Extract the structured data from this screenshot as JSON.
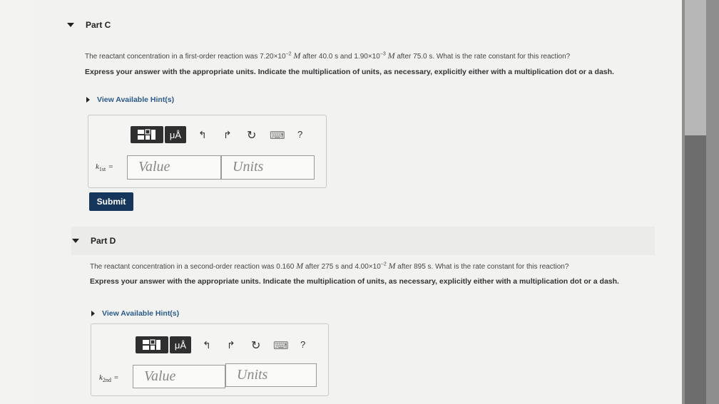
{
  "part_c": {
    "title": "Part C",
    "question_prefix": "The reactant concentration in a first-order reaction was 7.20×10",
    "exp1": "−2",
    "unit1": "M",
    "question_middle": " after 40.0 s and 1.90×10",
    "exp2": "−3",
    "unit2": "M",
    "question_suffix": " after 75.0 s. What is the rate constant for this reaction?",
    "instructions": "Express your answer with the appropriate units. Indicate the multiplication of units, as necessary, explicitly either with a multiplication dot or a dash.",
    "hint": "View Available Hint(s)",
    "var_main": "k",
    "var_sub": "1st",
    "eq": "=",
    "value_placeholder": "Value",
    "units_placeholder": "Units",
    "toolbar": {
      "mu_label": "μÅ",
      "undo": "↰",
      "redo": "↱",
      "reset": "↻",
      "keyboard": "⌨",
      "help": "?"
    },
    "submit": "Submit"
  },
  "part_d": {
    "title": "Part D",
    "question_prefix": "The reactant concentration in a second-order reaction was 0.160 ",
    "unit1": "M",
    "question_middle": " after 275 s and 4.00×10",
    "exp2": "−2",
    "unit2": "M",
    "question_suffix": " after 895 s. What is the rate constant for this reaction?",
    "instructions": "Express your answer with the appropriate units. Indicate the multiplication of units, as necessary, explicitly either with a multiplication dot or a dash.",
    "hint": "View Available Hint(s)",
    "var_main": "k",
    "var_sub": "2nd",
    "eq": "=",
    "value_placeholder": "Value",
    "units_placeholder": "Units",
    "toolbar": {
      "mu_label": "μÅ",
      "undo": "↰",
      "redo": "↱",
      "reset": "↻",
      "keyboard": "⌨",
      "help": "?"
    }
  },
  "colors": {
    "submit_bg": "#16365c",
    "toolbar_dark": "#2f2f2f",
    "hint_text": "#2a5a8a"
  }
}
